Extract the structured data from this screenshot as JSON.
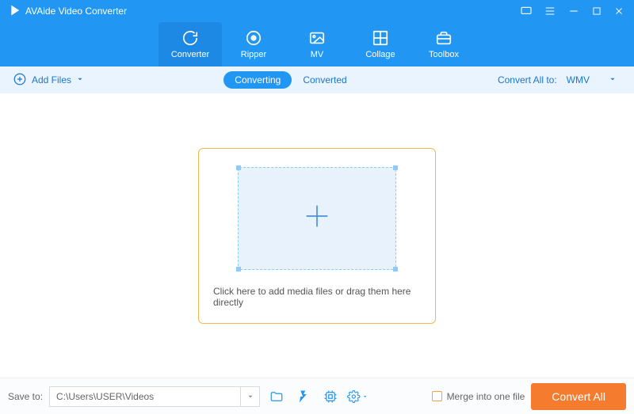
{
  "app": {
    "title": "AVAide Video Converter"
  },
  "nav": {
    "items": [
      {
        "label": "Converter"
      },
      {
        "label": "Ripper"
      },
      {
        "label": "MV"
      },
      {
        "label": "Collage"
      },
      {
        "label": "Toolbox"
      }
    ]
  },
  "options": {
    "add_files_label": "Add Files",
    "tabs": {
      "converting": "Converting",
      "converted": "Converted"
    },
    "convert_all_to_label": "Convert All to:",
    "convert_all_to_value": "WMV"
  },
  "dropzone": {
    "text": "Click here to add media files or drag them here directly"
  },
  "footer": {
    "save_to_label": "Save to:",
    "save_to_path": "C:\\Users\\USER\\Videos",
    "merge_label": "Merge into one file",
    "convert_all_label": "Convert All"
  }
}
